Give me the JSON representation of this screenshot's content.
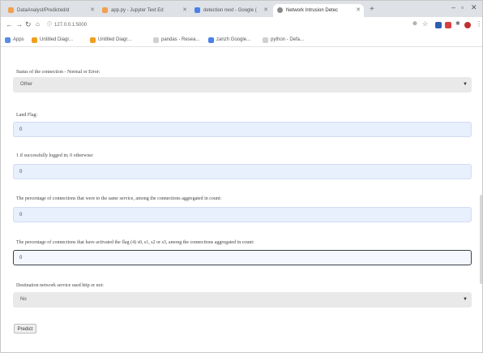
{
  "browser": {
    "tabs": [
      {
        "label": "DataAnalyst/Predicted/d"
      },
      {
        "label": "app.py - Jupyter Text Ed"
      },
      {
        "label": "detection next - Google ("
      },
      {
        "label": "Network Intrusion Detec",
        "active": true
      }
    ],
    "url": "127.0.0.1:5000",
    "bookmarks": [
      {
        "label": "Apps"
      },
      {
        "label": "Untitled Diagr..."
      },
      {
        "label": "Untitled Diagr..."
      },
      {
        "label": "pandas - Resea..."
      },
      {
        "label": "zanzh Google..."
      },
      {
        "label": "python - Defa..."
      }
    ]
  },
  "form": {
    "status_label": "Status of the connection - Normal or Error:",
    "status_value": "Other",
    "land_label": "Land Flag:",
    "land_value": "0",
    "login_label": "1 if successfully logged in; 0 otherwise:",
    "login_value": "0",
    "same_service_label": "The percentage of connections that were to the same service, among the connections aggregated in count:",
    "same_service_value": "0",
    "flag_label": "The percentage of connections that have activated the flag (4) s0, s1, s2 or s3, among the connections aggregated in count:",
    "flag_value": "0",
    "service_label": "Destination network service used http or not:",
    "service_value": "No",
    "predict_label": "Predict"
  }
}
